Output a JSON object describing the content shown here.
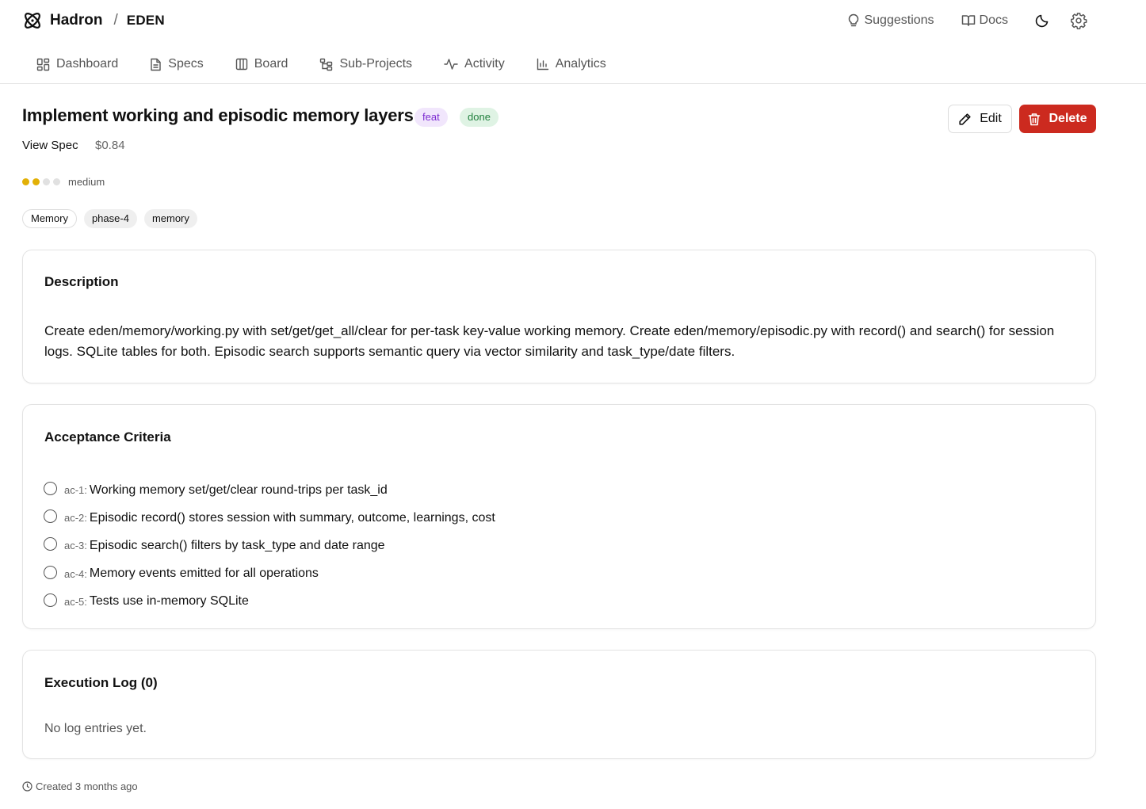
{
  "app": {
    "name": "Hadron",
    "separator": "/",
    "project": "EDEN",
    "logo_icon": "atom-logo-icon"
  },
  "top_actions": {
    "suggestions_label": "Suggestions",
    "docs_label": "Docs",
    "theme_icon": "moon-icon",
    "settings_icon": "gear-icon"
  },
  "nav": {
    "items": [
      {
        "label": "Dashboard",
        "icon": "dashboard-icon"
      },
      {
        "label": "Specs",
        "icon": "document-icon"
      },
      {
        "label": "Board",
        "icon": "columns-icon"
      },
      {
        "label": "Sub-Projects",
        "icon": "tree-icon"
      },
      {
        "label": "Activity",
        "icon": "pulse-icon"
      },
      {
        "label": "Analytics",
        "icon": "bar-chart-icon"
      }
    ]
  },
  "task": {
    "title": "Implement working and episodic memory layers",
    "type_badge": "feat",
    "status_badge": "done",
    "view_spec_label": "View Spec",
    "cost": "$0.84",
    "priority": {
      "label": "medium",
      "level": 2,
      "max": 4
    },
    "tags": [
      "Memory",
      "phase-4",
      "memory"
    ],
    "edit_label": "Edit",
    "delete_label": "Delete"
  },
  "colors": {
    "delete_bg": "#cc2a1f",
    "priority_on": "#e2b007",
    "feat_bg": "#f1e6fc",
    "feat_text": "#7c2bd1",
    "done_bg": "#dff3e4",
    "done_text": "#21803e"
  },
  "description": {
    "heading": "Description",
    "text": "Create eden/memory/working.py with set/get/get_all/clear for per-task key-value working memory. Create eden/memory/episodic.py with record() and search() for session logs. SQLite tables for both. Episodic search supports semantic query via vector similarity and task_type/date filters."
  },
  "acceptance": {
    "heading": "Acceptance Criteria",
    "items": [
      {
        "id": "ac-1:",
        "text": "Working memory set/get/clear round-trips per task_id",
        "checked": false
      },
      {
        "id": "ac-2:",
        "text": "Episodic record() stores session with summary, outcome, learnings, cost",
        "checked": false
      },
      {
        "id": "ac-3:",
        "text": "Episodic search() filters by task_type and date range",
        "checked": false
      },
      {
        "id": "ac-4:",
        "text": "Memory events emitted for all operations",
        "checked": false
      },
      {
        "id": "ac-5:",
        "text": "Tests use in-memory SQLite",
        "checked": false
      }
    ]
  },
  "execution_log": {
    "heading": "Execution Log (0)",
    "empty_text": "No log entries yet."
  },
  "footer": {
    "created": "Created 3 months ago",
    "icon": "clock-icon"
  }
}
